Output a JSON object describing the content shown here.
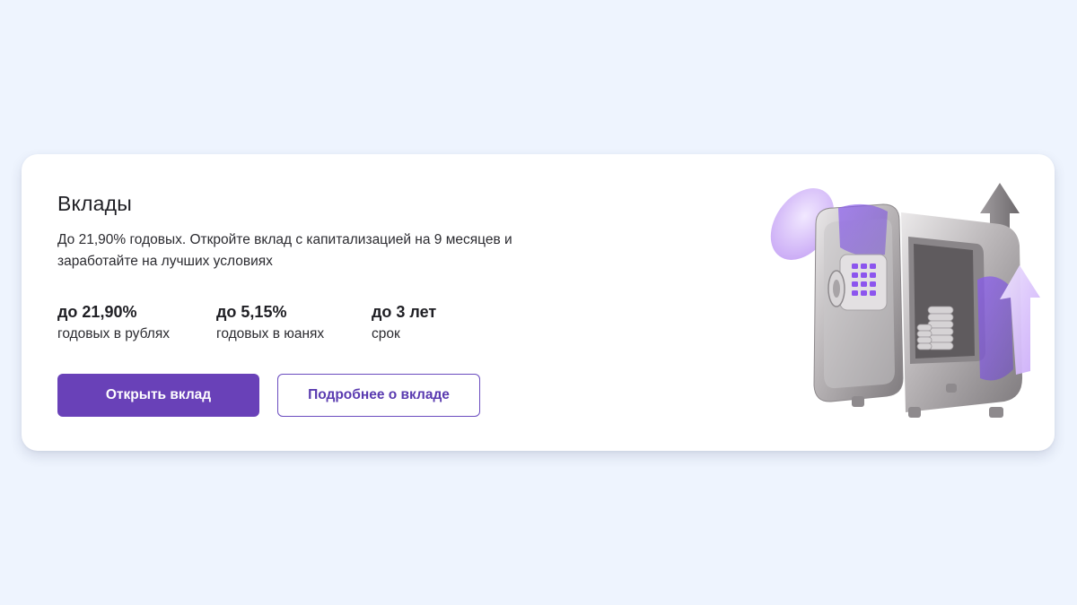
{
  "card": {
    "title": "Вклады",
    "description": "До 21,90% годовых. Откройте вклад с капитализацией на 9 месяцев и заработайте на лучших условиях",
    "stats": [
      {
        "value": "до 21,90%",
        "label": "годовых в рублях"
      },
      {
        "value": "до 5,15%",
        "label": "годовых в юанях"
      },
      {
        "value": "до 3 лет",
        "label": "срок"
      }
    ],
    "buttons": {
      "primary": "Открыть вклад",
      "secondary": "Подробнее о вкладе"
    },
    "illustration": {
      "icon": "safe-with-coins-icon"
    }
  },
  "colors": {
    "background": "#eef4fe",
    "card": "#ffffff",
    "accent": "#6941b8",
    "text": "#1f1f24"
  }
}
